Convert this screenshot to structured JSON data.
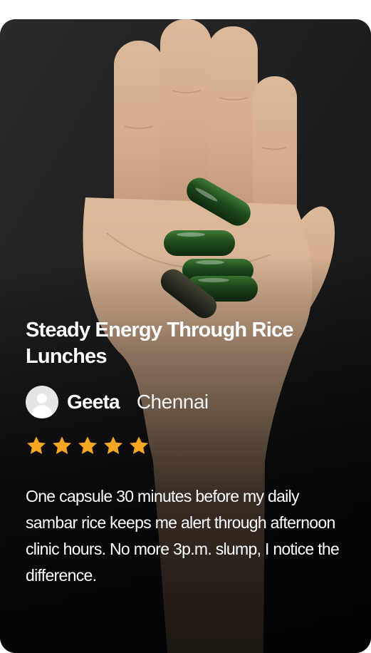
{
  "testimonial": {
    "title": "Steady Energy Through Rice Lunches",
    "author": {
      "name": "Geeta",
      "city": "Chennai",
      "avatar_icon": "user-avatar-icon"
    },
    "rating": 5,
    "star_color": "#f5a623",
    "review": "One capsule 30 minutes before my daily sambar rice keeps me alert through afternoon clinic hours. No more 3p.m. slump, I notice the difference.",
    "photo_subject": "open palm holding five green capsules"
  }
}
